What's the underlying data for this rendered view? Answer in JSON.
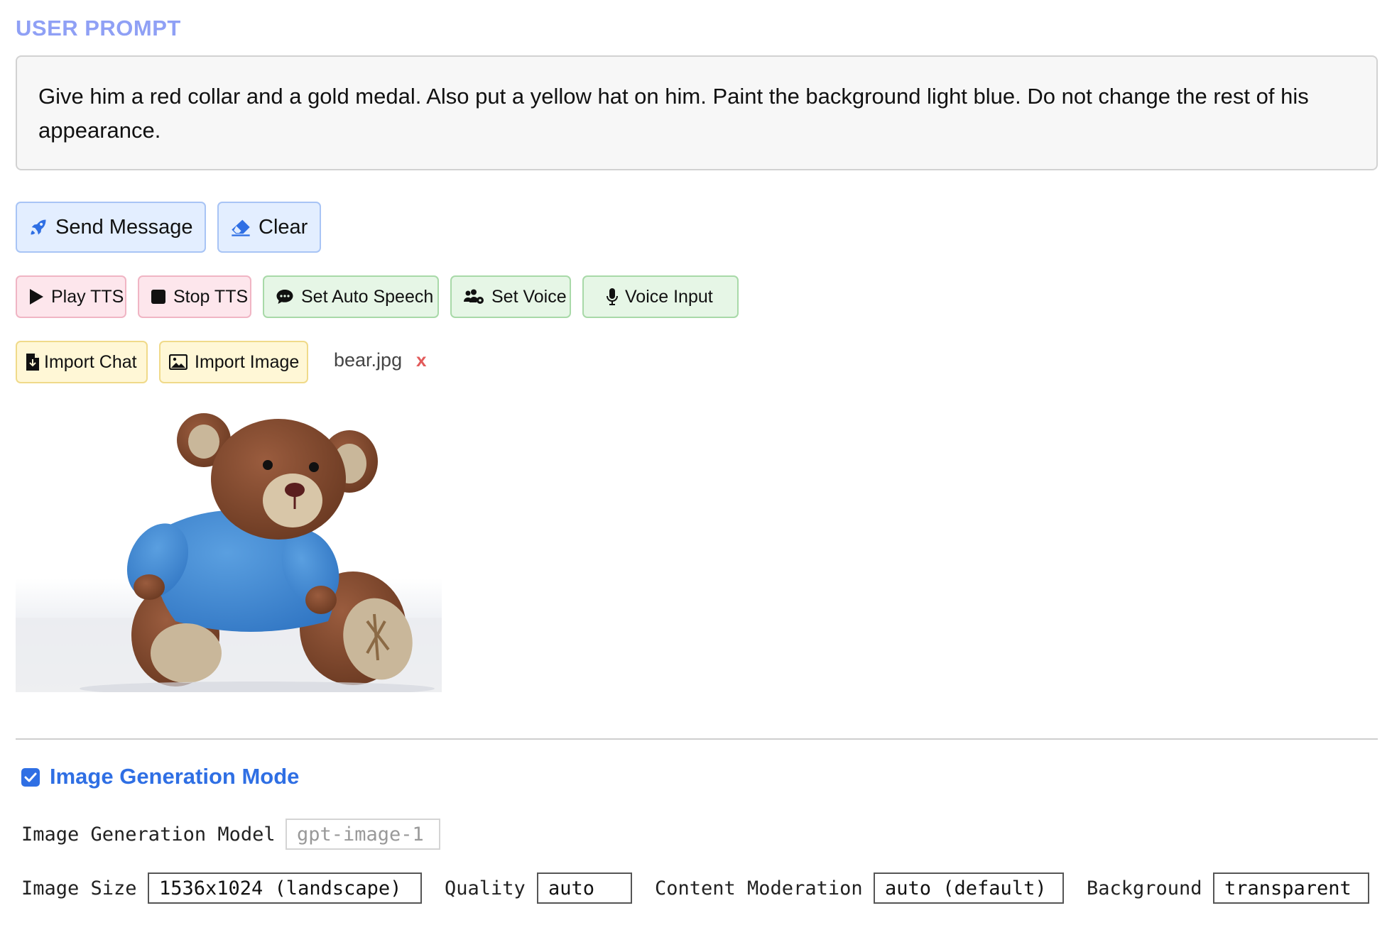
{
  "section": {
    "label": "USER PROMPT"
  },
  "prompt": {
    "text": "Give him a red collar and a gold medal. Also put a yellow hat on him. Paint the background light blue. Do not change the rest of his appearance."
  },
  "buttons": {
    "send": "Send Message",
    "clear": "Clear",
    "play_tts": "Play TTS",
    "stop_tts": "Stop TTS",
    "auto_speech": "Set Auto Speech",
    "set_voice": "Set Voice",
    "voice_input": "Voice Input",
    "import_chat": "Import Chat",
    "import_image": "Import Image"
  },
  "attachment": {
    "filename": "bear.jpg",
    "remove": "x",
    "preview_icon": "teddy-bear-image"
  },
  "image_mode": {
    "label": "Image Generation Mode",
    "checked": true,
    "model_label": "Image Generation Model",
    "model_value": "gpt-image-1",
    "size_label": "Image Size",
    "size_value": "1536x1024 (landscape)",
    "quality_label": "Quality",
    "quality_value": "auto",
    "moderation_label": "Content Moderation",
    "moderation_value": "auto (default)",
    "background_label": "Background",
    "background_value": "transparent"
  },
  "colors": {
    "accent": "#2f6fe4",
    "label": "#8fa0f5",
    "remove": "#e25a5a"
  }
}
